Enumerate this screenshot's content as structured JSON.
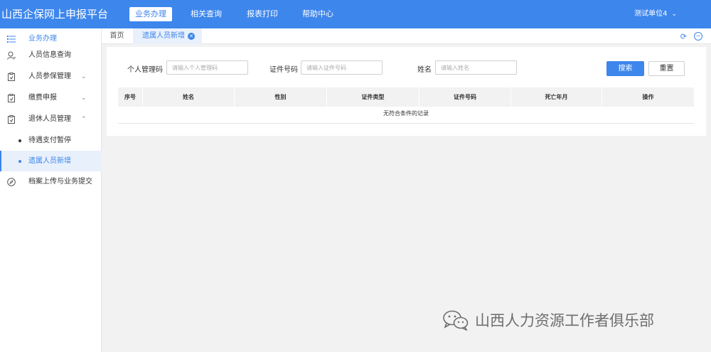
{
  "app": {
    "title": "山西企保网上申报平台"
  },
  "top_nav": [
    {
      "label": "业务办理",
      "active": true
    },
    {
      "label": "相关查询",
      "active": false
    },
    {
      "label": "报表打印",
      "active": false
    },
    {
      "label": "帮助中心",
      "active": false
    }
  ],
  "user": {
    "name": "测试单位4",
    "icon": "chevron-down-icon"
  },
  "sidebar": {
    "items": [
      {
        "label": "业务办理",
        "icon": "list-icon"
      },
      {
        "label": "人员信息查询",
        "icon": "user-search-icon"
      },
      {
        "label": "人员参保管理",
        "icon": "clipboard-icon"
      },
      {
        "label": "缴费申报",
        "icon": "clipboard-icon"
      },
      {
        "label": "退休人员管理",
        "icon": "clipboard-icon"
      },
      {
        "label": "档案上传与业务提交",
        "icon": "compass-icon"
      }
    ],
    "sub_items": [
      {
        "label": "待遇支付暂停",
        "active": false
      },
      {
        "label": "遗属人员新增",
        "active": true
      }
    ]
  },
  "tabs": {
    "home": "首页",
    "current": "遗属人员新增"
  },
  "search": {
    "personal_code_label": "个人管理码",
    "personal_code_placeholder": "请输入个人管理码",
    "id_number_label": "证件号码",
    "id_number_placeholder": "请输入证件号码",
    "name_label": "姓名",
    "name_placeholder": "请输入姓名",
    "search_button": "搜索",
    "reset_button": "重置"
  },
  "table": {
    "columns": [
      "序号",
      "姓名",
      "性别",
      "证件类型",
      "证件号码",
      "死亡年月",
      "操作"
    ],
    "empty_text": "无符合条件的记录"
  },
  "watermark": {
    "text": "山西人力资源工作者俱乐部"
  },
  "colors": {
    "primary": "#3d86ec",
    "active_bg": "#e8f0fc"
  }
}
